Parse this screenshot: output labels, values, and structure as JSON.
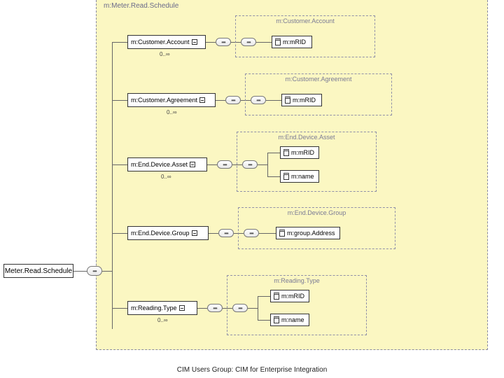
{
  "schedule": {
    "title": "m:Meter.Read.Schedule"
  },
  "root": {
    "label": "Meter.Read.Schedule"
  },
  "groups": {
    "customerAccount": {
      "title": "m:Customer.Account",
      "element": "m:Customer.Account",
      "card": "0..∞",
      "attrs": {
        "mrid": "m:mRID"
      }
    },
    "customerAgreement": {
      "title": "m:Customer.Agreement",
      "element": "m:Customer.Agreement",
      "card": "0..∞",
      "attrs": {
        "mrid": "m:mRID"
      }
    },
    "endDeviceAsset": {
      "title": "m:End.Device.Asset",
      "element": "m:End.Device.Asset",
      "card": "0..∞",
      "attrs": {
        "mrid": "m:mRID",
        "name": "m:name"
      }
    },
    "endDeviceGroup": {
      "title": "m:End.Device.Group",
      "element": "m:End.Device.Group",
      "card": "",
      "attrs": {
        "groupAddress": "m:group.Address"
      }
    },
    "readingType": {
      "title": "m:Reading.Type",
      "element": "m:Reading.Type",
      "card": "0..∞",
      "attrs": {
        "mrid": "m:mRID",
        "name": "m:name"
      }
    }
  },
  "footer": "CIM Users Group: CIM for Enterprise Integration"
}
